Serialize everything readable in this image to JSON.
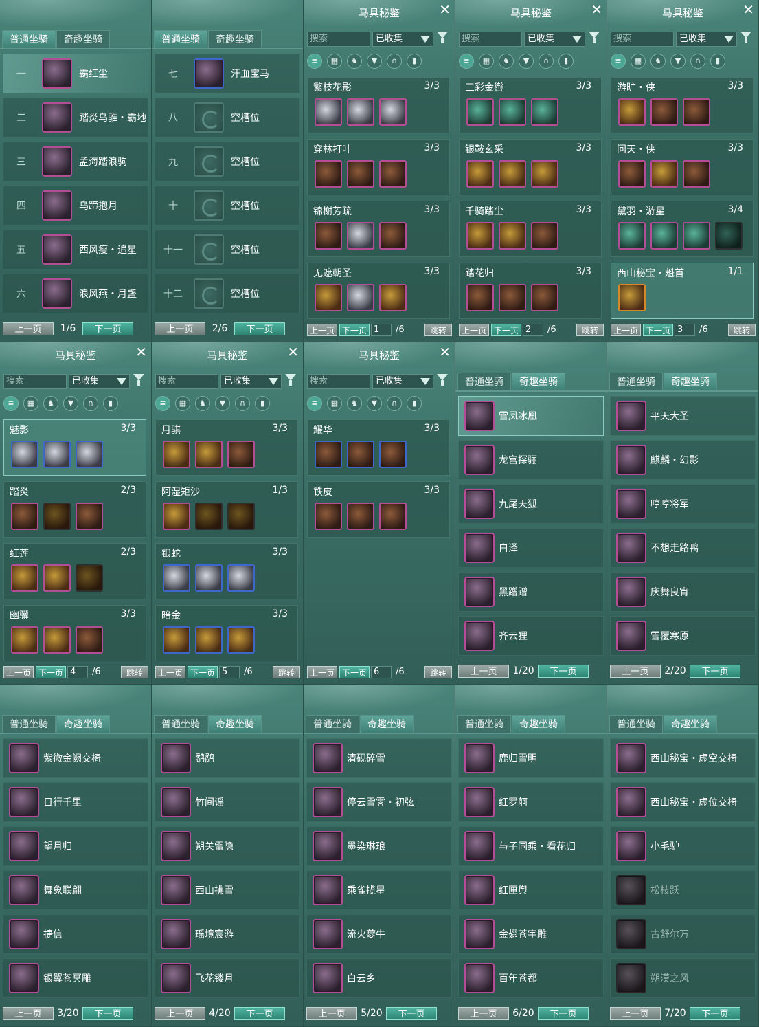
{
  "tabs": {
    "normal": "普通坐骑",
    "fun": "奇趣坐骑"
  },
  "pager": {
    "prev": "上一页",
    "next": "下一页",
    "jump": "跳转"
  },
  "collection": {
    "title": "马具秘鉴",
    "search_placeholder": "搜索",
    "filter": "已收集"
  },
  "normal_pages": [
    {
      "page": "1/6",
      "rows": [
        {
          "num": "一",
          "name": "霸红尘"
        },
        {
          "num": "二",
          "name": "踏炎乌骓・霸地"
        },
        {
          "num": "三",
          "name": "孟海踏浪驹"
        },
        {
          "num": "四",
          "name": "乌蹄抱月"
        },
        {
          "num": "五",
          "name": "西风瘦・追星"
        },
        {
          "num": "六",
          "name": "浪风燕・月盏"
        }
      ]
    },
    {
      "page": "2/6",
      "rows": [
        {
          "num": "七",
          "name": "汗血宝马"
        },
        {
          "num": "八",
          "name": "空槽位"
        },
        {
          "num": "九",
          "name": "空槽位"
        },
        {
          "num": "十",
          "name": "空槽位"
        },
        {
          "num": "十一",
          "name": "空槽位"
        },
        {
          "num": "十二",
          "name": "空槽位"
        }
      ]
    }
  ],
  "sets_pages": [
    {
      "page": "1",
      "total": "/6",
      "sets": [
        {
          "name": "繁枝花影",
          "count": "3/3"
        },
        {
          "name": "穿林打叶",
          "count": "3/3"
        },
        {
          "name": "锦榭芳疏",
          "count": "3/3"
        },
        {
          "name": "无遮朝圣",
          "count": "3/3"
        }
      ]
    },
    {
      "page": "2",
      "total": "/6",
      "sets": [
        {
          "name": "三彩金辔",
          "count": "3/3"
        },
        {
          "name": "银鞍玄采",
          "count": "3/3"
        },
        {
          "name": "千骑踏尘",
          "count": "3/3"
        },
        {
          "name": "踏花归",
          "count": "3/3"
        }
      ]
    },
    {
      "page": "3",
      "total": "/6",
      "sets": [
        {
          "name": "游旷・侠",
          "count": "3/3"
        },
        {
          "name": "问天・侠",
          "count": "3/3"
        },
        {
          "name": "黛羽・游星",
          "count": "3/4"
        },
        {
          "name": "西山秘宝・魁首",
          "count": "1/1"
        }
      ]
    },
    {
      "page": "4",
      "total": "/6",
      "sets": [
        {
          "name": "魅影",
          "count": "3/3"
        },
        {
          "name": "踏炎",
          "count": "2/3"
        },
        {
          "name": "红莲",
          "count": "2/3"
        },
        {
          "name": "幽骥",
          "count": "3/3"
        }
      ]
    },
    {
      "page": "5",
      "total": "/6",
      "sets": [
        {
          "name": "月骐",
          "count": "3/3"
        },
        {
          "name": "阿湿矩沙",
          "count": "1/3"
        },
        {
          "name": "银蛇",
          "count": "3/3"
        },
        {
          "name": "暗金",
          "count": "3/3"
        }
      ]
    },
    {
      "page": "6",
      "total": "/6",
      "sets": [
        {
          "name": "耀华",
          "count": "3/3"
        },
        {
          "name": "铁皮",
          "count": "3/3"
        }
      ]
    }
  ],
  "fun_pages": [
    {
      "page": "1/20",
      "rows": [
        "雪凤冰凰",
        "龙宫探骊",
        "九尾天狐",
        "白泽",
        "黑蹭蹭",
        "齐云狸"
      ]
    },
    {
      "page": "2/20",
      "rows": [
        "平天大圣",
        "麒麟・幻影",
        "哼哼将军",
        "不想走路鸭",
        "庆舞良宵",
        "雪覆寒原"
      ]
    },
    {
      "page": "3/20",
      "rows": [
        "紫微金阙交椅",
        "日行千里",
        "望月归",
        "舞象联翩",
        "捷信",
        "银翼苍冥雕"
      ]
    },
    {
      "page": "4/20",
      "rows": [
        "鹬鹬",
        "竹间谣",
        "朔关雷隐",
        "西山拂雪",
        "瑶境宸游",
        "飞花镂月"
      ]
    },
    {
      "page": "5/20",
      "rows": [
        "清砚碎雪",
        "停云雪霁・初弦",
        "墨染琳琅",
        "乘雀揽星",
        "流火夔牛",
        "白云乡"
      ]
    },
    {
      "page": "6/20",
      "rows": [
        "鹿归雪明",
        "红罗舸",
        "与子同乘・看花归",
        "红匣舆",
        "金翅苍宇雕",
        "百年苍都"
      ]
    },
    {
      "page": "7/20",
      "rows": [
        "西山秘宝・虚空交椅",
        "西山秘宝・虚位交椅",
        "小毛驴",
        "松枝跃",
        "古舒尔万",
        "朔漠之风"
      ]
    }
  ],
  "colors": {
    "accent": "#4fb39f",
    "frame_rare": "#b24d96",
    "frame_blue": "#3d67c8"
  }
}
